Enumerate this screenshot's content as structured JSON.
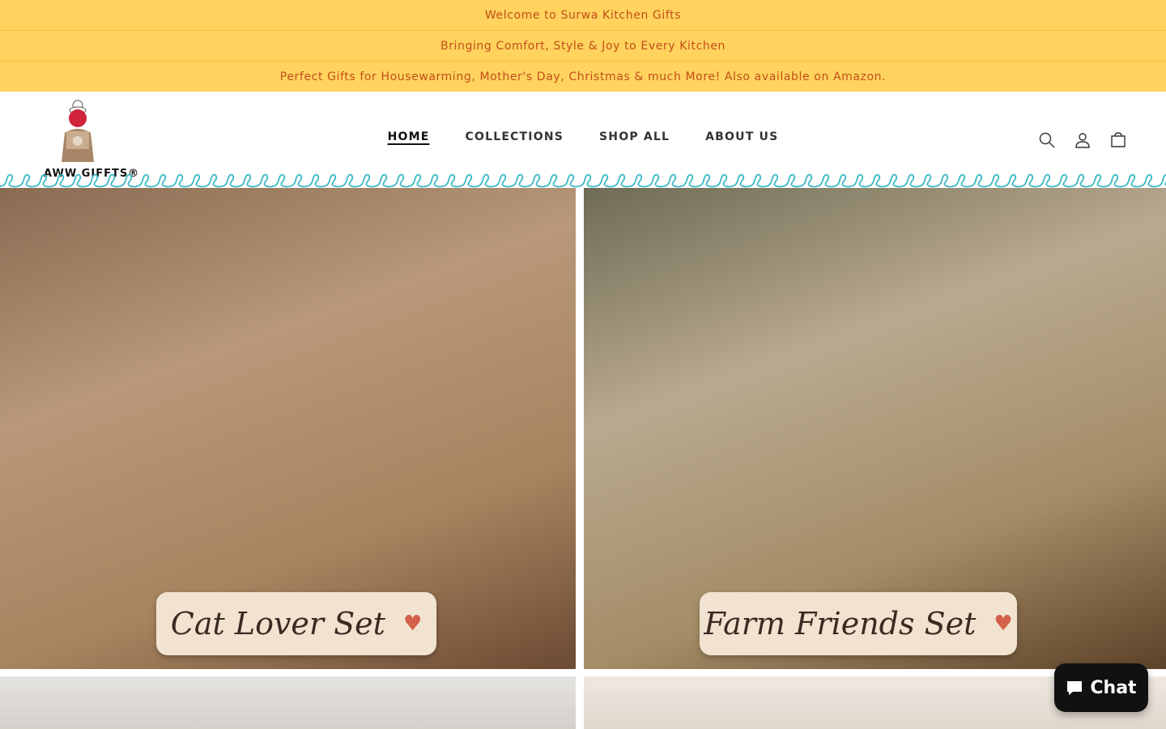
{
  "announcements": [
    "Welcome to Surwa Kitchen Gifts",
    "Bringing Comfort, Style & Joy to Every Kitchen",
    "Perfect Gifts for Housewarming, Mother's Day, Christmas & much More! Also available on Amazon."
  ],
  "brand": {
    "logo_text": "AWW GIFFTS®"
  },
  "nav": [
    {
      "label": "HOME",
      "active": true
    },
    {
      "label": "COLLECTIONS",
      "active": false
    },
    {
      "label": "SHOP ALL",
      "active": false
    },
    {
      "label": "ABOUT US",
      "active": false
    }
  ],
  "header_icons": [
    "search-icon",
    "account-icon",
    "cart-icon"
  ],
  "tiles": [
    {
      "label": "Cat Lover Set"
    },
    {
      "label": "Farm Friends Set"
    }
  ],
  "chat": {
    "label": "Chat"
  },
  "colors": {
    "announcement_bg": "#ffd35d",
    "announcement_text": "#c24e1b",
    "scallop": "#3bb8c2",
    "heart": "#d46048"
  }
}
